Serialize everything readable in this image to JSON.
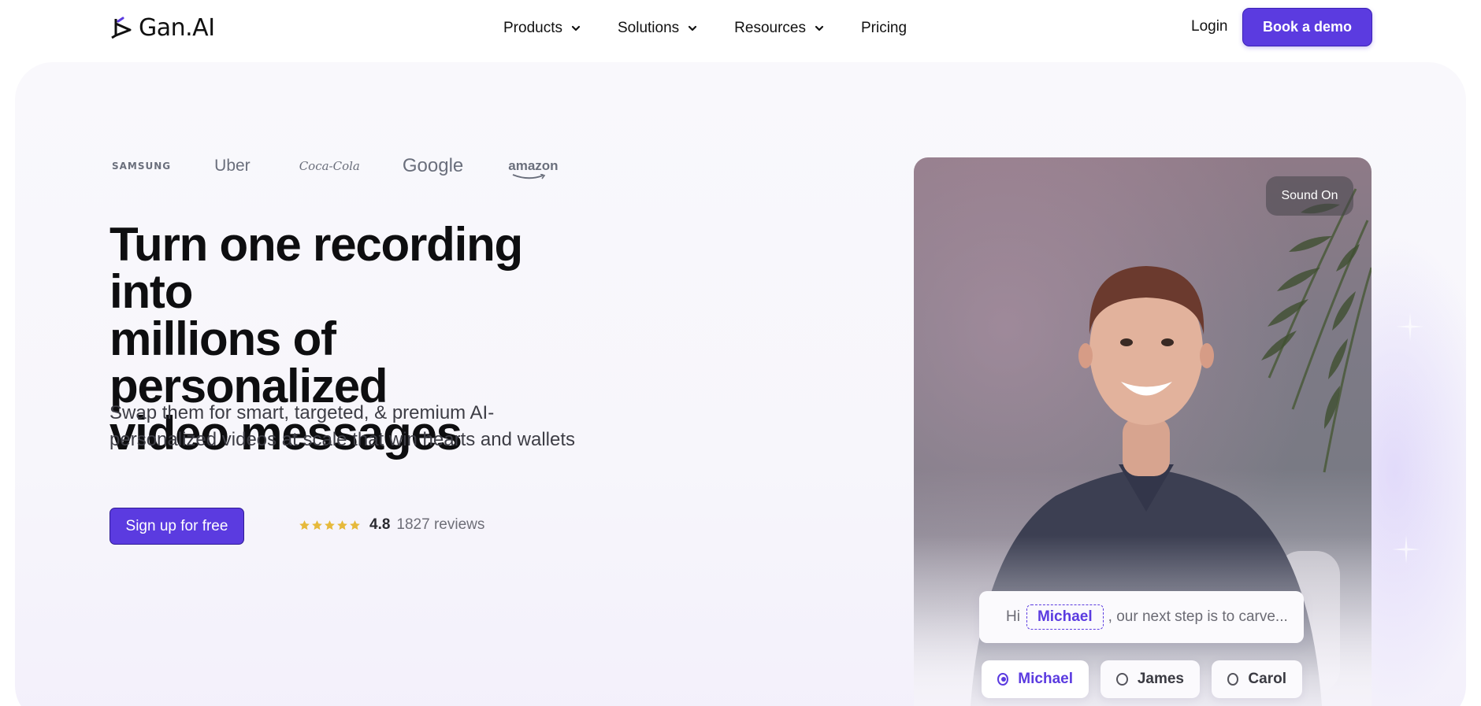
{
  "header": {
    "logo_text": "Gan.AI",
    "nav": [
      {
        "label": "Products",
        "has_dropdown": true
      },
      {
        "label": "Solutions",
        "has_dropdown": true
      },
      {
        "label": "Resources",
        "has_dropdown": true
      },
      {
        "label": "Pricing",
        "has_dropdown": false
      }
    ],
    "login_label": "Login",
    "cta_label": "Book a demo"
  },
  "hero": {
    "brands": [
      "SAMSUNG",
      "Uber",
      "Coca-Cola",
      "Google",
      "amazon"
    ],
    "headline": [
      "Turn one recording into",
      "millions of personalized",
      "video messages"
    ],
    "subtext": [
      "Swap them for smart, targeted, & premium AI-",
      "personalized videos at scale that win hearts and wallets"
    ],
    "signup_label": "Sign up for free",
    "rating": {
      "stars": 5,
      "value": "4.8",
      "count": "1827 reviews"
    }
  },
  "video": {
    "sound_label": "Sound On",
    "caption": {
      "prefix": "Hi",
      "name": "Michael",
      "suffix": ", our next step is to carve..."
    },
    "name_options": [
      {
        "label": "Michael",
        "selected": true
      },
      {
        "label": "James",
        "selected": false
      },
      {
        "label": "Carol",
        "selected": false
      }
    ]
  },
  "colors": {
    "brand": "#5b3be0",
    "star": "#e6b93b",
    "text": "#0e0e10",
    "muted": "#6a6f7c"
  },
  "icons": [
    "gan-logo-icon",
    "chevron-down-icon",
    "star-icon",
    "radio-icon"
  ]
}
